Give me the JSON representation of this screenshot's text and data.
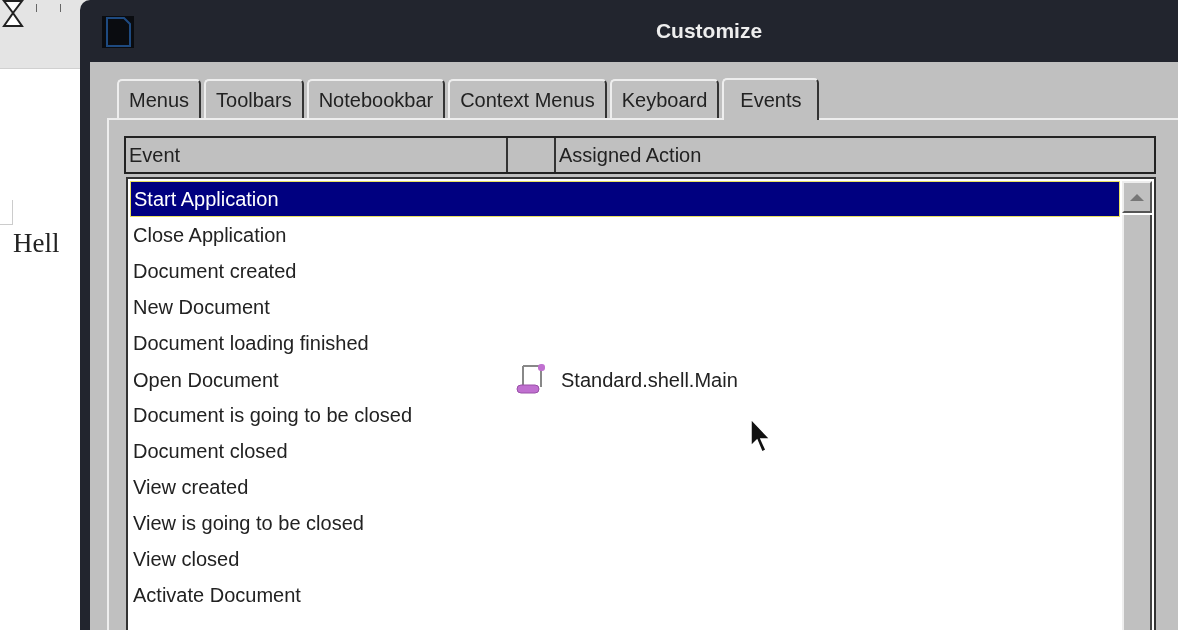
{
  "document": {
    "text": "Hell"
  },
  "dialog": {
    "title": "Customize",
    "tabs": [
      {
        "label": "Menus",
        "selected": false
      },
      {
        "label": "Toolbars",
        "selected": false
      },
      {
        "label": "Notebookbar",
        "selected": false
      },
      {
        "label": "Context Menus",
        "selected": false
      },
      {
        "label": "Keyboard",
        "selected": false
      },
      {
        "label": "Events",
        "selected": true
      }
    ],
    "table": {
      "columns": [
        "Event",
        "Assigned Action"
      ],
      "rows": [
        {
          "event": "Start Application",
          "selected": true
        },
        {
          "event": "Close Application",
          "selected": false
        },
        {
          "event": "Document created",
          "selected": false
        },
        {
          "event": "New Document",
          "selected": false
        },
        {
          "event": "Document loading finished",
          "selected": false
        },
        {
          "event": "Open Document",
          "action": "Standard.shell.Main",
          "selected": false
        },
        {
          "event": "Document is going to be closed",
          "selected": false
        },
        {
          "event": "Document closed",
          "selected": false
        },
        {
          "event": "View created",
          "selected": false
        },
        {
          "event": "View is going to be closed",
          "selected": false
        },
        {
          "event": "View closed",
          "selected": false
        },
        {
          "event": "Activate Document",
          "selected": false
        }
      ]
    }
  }
}
